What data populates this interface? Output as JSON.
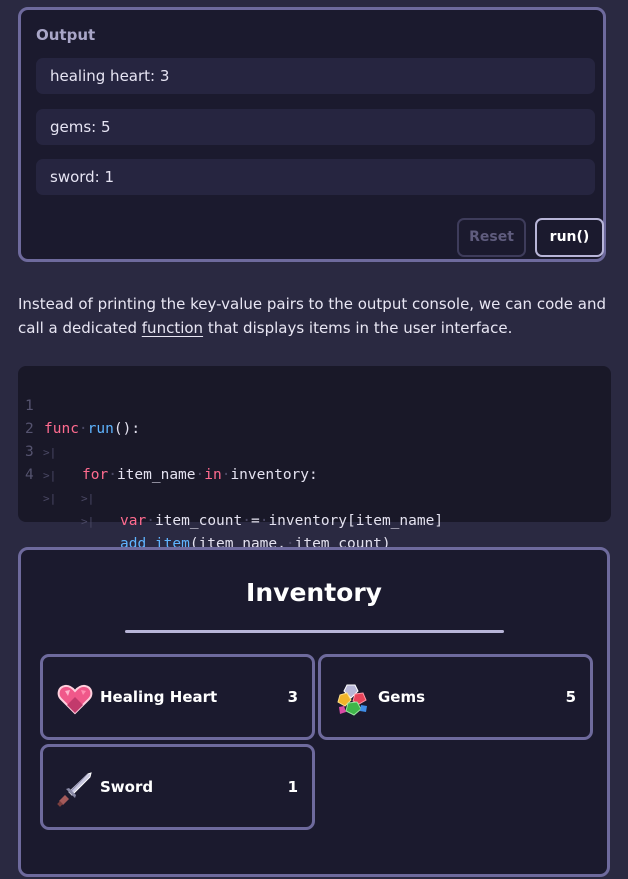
{
  "output": {
    "title": "Output",
    "lines": [
      "healing heart: 3",
      "gems: 5",
      "sword: 1"
    ],
    "reset_label": "Reset",
    "run_label": "run()"
  },
  "paragraph": {
    "before": "Instead of printing the key-value pairs to the output console, we can code and call a dedicated ",
    "link": "function",
    "after": " that displays items in the user interface."
  },
  "code": {
    "line_numbers": [
      "1",
      "2",
      "3",
      "4"
    ],
    "line1": {
      "kw": "func",
      "fn": "run",
      "rest": "():"
    },
    "line2": {
      "kw": "for",
      "var": "item_name",
      "kw2": "in",
      "rest": "inventory:"
    },
    "line3": {
      "kw": "var",
      "var": "item_count",
      "op": "=",
      "rest": "inventory[item_name]"
    },
    "line4": {
      "fn": "add_item",
      "rest": "(item_name,",
      "rest2": "item_count)"
    }
  },
  "inventory": {
    "title": "Inventory",
    "items": [
      {
        "name": "Healing Heart",
        "count": "3",
        "icon": "heart-icon"
      },
      {
        "name": "Gems",
        "count": "5",
        "icon": "gems-icon"
      },
      {
        "name": "Sword",
        "count": "1",
        "icon": "sword-icon"
      }
    ]
  },
  "colors": {
    "background": "#2a2941",
    "panel": "#1b1a2e",
    "border": "#6e6a9d",
    "keyword": "#ff6b8f",
    "function": "#5fb4ff"
  }
}
